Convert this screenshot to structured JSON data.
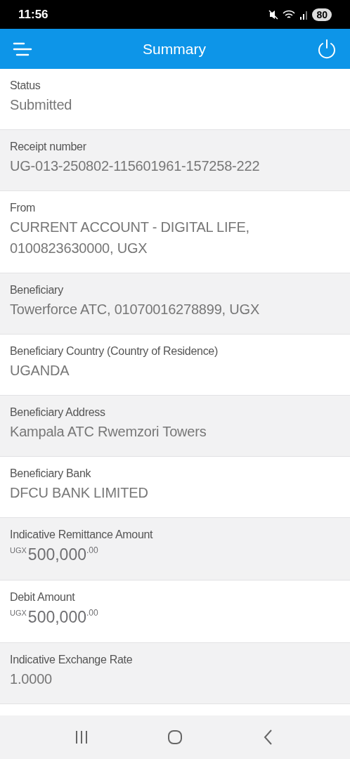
{
  "status_bar": {
    "time": "11:56",
    "battery": "80"
  },
  "header": {
    "title": "Summary"
  },
  "rows": [
    {
      "kind": "text",
      "label": "Status",
      "value": "Submitted"
    },
    {
      "kind": "text",
      "label": "Receipt number",
      "value": "UG-013-250802-115601961-157258-222"
    },
    {
      "kind": "text",
      "label": "From",
      "value": "CURRENT ACCOUNT - DIGITAL LIFE, 0100823630000, UGX"
    },
    {
      "kind": "text",
      "label": "Beneficiary",
      "value": "Towerforce ATC, 01070016278899, UGX"
    },
    {
      "kind": "text",
      "label": "Beneficiary Country (Country of Residence)",
      "value": "UGANDA"
    },
    {
      "kind": "text",
      "label": "Beneficiary Address",
      "value": "Kampala ATC Rwemzori Towers"
    },
    {
      "kind": "text",
      "label": "Beneficiary Bank",
      "value": "DFCU BANK LIMITED"
    },
    {
      "kind": "amount",
      "label": "Indicative Remittance Amount",
      "currency": "UGX",
      "whole": "500,000",
      "fraction": ".00"
    },
    {
      "kind": "amount",
      "label": "Debit Amount",
      "currency": "UGX",
      "whole": "500,000",
      "fraction": ".00"
    },
    {
      "kind": "text",
      "label": "Indicative Exchange Rate",
      "value": "1.0000"
    }
  ]
}
